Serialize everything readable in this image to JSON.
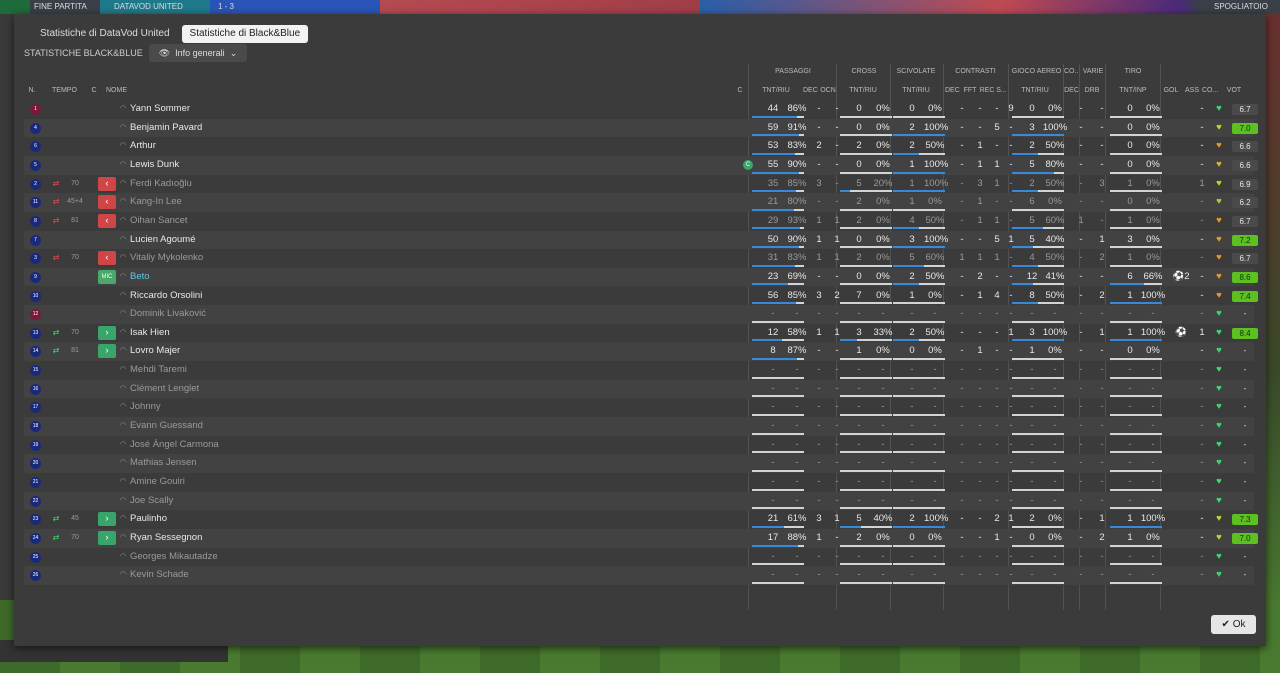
{
  "topbar": {
    "left": "FINE PARTITA",
    "team": "DATAVOD UNITED",
    "score": "1 - 3",
    "right": "SPOGLIATOIO"
  },
  "tabs": [
    {
      "label": "Statistiche di DataVod United",
      "active": false
    },
    {
      "label": "Statistiche di Black&Blue",
      "active": true
    }
  ],
  "subtitle": "STATISTICHE BLACK&BLUE",
  "dropdown": "Info generali",
  "groups": {
    "passaggi": "PASSAGGI",
    "cross": "CROSS",
    "scivolate": "SCIVOLATE",
    "contrasti": "CONTRASTI",
    "gioco_aereo": "GIOCO AEREO",
    "co": "CO...",
    "varie": "VARIE",
    "tiro": "TIRO"
  },
  "headers": {
    "n": "N.",
    "tempo": "TEMPO",
    "c": "C",
    "nome": "NOME",
    "c2": "C",
    "pass": "TNT/RIU",
    "pass_dec": "DEC",
    "pass_ocn": "OCN",
    "cross": "TNT/RIU",
    "sciv": "TNT/RIU",
    "con_dec": "DEC",
    "con_fft": "FFT",
    "con_rec": "REC",
    "con_s": "S...",
    "aereo": "TNT/RIU",
    "co_dec": "DEC",
    "drb": "DRB",
    "tiro": "TNT/INP",
    "gol": "GOL",
    "ass": "ASS",
    "cond": "CO...",
    "vot": "VOT"
  },
  "ok_label": "Ok",
  "players": [
    {
      "n": "1",
      "name": "Yann Sommer",
      "kit": "#7a1a3a",
      "sub": "",
      "tempo": "",
      "role": "",
      "pas": "44",
      "pasp": "86%",
      "pd": "-",
      "po": "-",
      "cr": "0",
      "crp": "0%",
      "sc": "0",
      "scp": "0%",
      "cd": "-",
      "cf": "-",
      "cre": "-",
      "cs": "9",
      "ae": "0",
      "aep": "0%",
      "od": "-",
      "dr": "-",
      "ti": "0",
      "tip": "0%",
      "gol": "",
      "ass": "-",
      "heart": "#39d96a",
      "vot": "6.7",
      "vhi": false,
      "active": true,
      "cap": false
    },
    {
      "n": "4",
      "name": "Benjamin Pavard",
      "kit": "#1a2a7a",
      "sub": "",
      "tempo": "",
      "role": "",
      "pas": "59",
      "pasp": "91%",
      "pd": "-",
      "po": "-",
      "cr": "0",
      "crp": "0%",
      "sc": "2",
      "scp": "100%",
      "cd": "-",
      "cf": "-",
      "cre": "5",
      "cs": "-",
      "ae": "3",
      "aep": "100%",
      "od": "-",
      "dr": "-",
      "ti": "0",
      "tip": "0%",
      "gol": "",
      "ass": "-",
      "heart": "#c8d030",
      "vot": "7.0",
      "vhi": true,
      "active": true,
      "cap": false
    },
    {
      "n": "6",
      "name": "Arthur",
      "kit": "#1a2a7a",
      "sub": "",
      "tempo": "",
      "role": "",
      "pas": "53",
      "pasp": "83%",
      "pd": "2",
      "po": "-",
      "cr": "2",
      "crp": "0%",
      "sc": "2",
      "scp": "50%",
      "cd": "-",
      "cf": "1",
      "cre": "-",
      "cs": "-",
      "ae": "2",
      "aep": "50%",
      "od": "-",
      "dr": "-",
      "ti": "0",
      "tip": "0%",
      "gol": "",
      "ass": "-",
      "heart": "#e09a30",
      "vot": "6.6",
      "vhi": false,
      "active": true,
      "cap": false
    },
    {
      "n": "5",
      "name": "Lewis Dunk",
      "kit": "#1a2a7a",
      "sub": "",
      "tempo": "",
      "role": "",
      "pas": "55",
      "pasp": "90%",
      "pd": "-",
      "po": "-",
      "cr": "0",
      "crp": "0%",
      "sc": "1",
      "scp": "100%",
      "cd": "-",
      "cf": "1",
      "cre": "1",
      "cs": "-",
      "ae": "5",
      "aep": "80%",
      "od": "-",
      "dr": "-",
      "ti": "0",
      "tip": "0%",
      "gol": "",
      "ass": "-",
      "heart": "#e0b030",
      "vot": "6.6",
      "vhi": false,
      "active": true,
      "cap": true
    },
    {
      "n": "2",
      "name": "Ferdi Kadıoğlu",
      "kit": "#1a2a7a",
      "sub": "out",
      "tempo": "70",
      "role": "",
      "pas": "35",
      "pasp": "85%",
      "pd": "3",
      "po": "-",
      "cr": "5",
      "crp": "20%",
      "sc": "1",
      "scp": "100%",
      "cd": "-",
      "cf": "3",
      "cre": "1",
      "cs": "-",
      "ae": "2",
      "aep": "50%",
      "od": "-",
      "dr": "3",
      "ti": "1",
      "tip": "0%",
      "gol": "",
      "ass": "1",
      "heart": "#c8d030",
      "vot": "6.9",
      "vhi": false,
      "active": false,
      "cap": false
    },
    {
      "n": "11",
      "name": "Kang-In Lee",
      "kit": "#1a2a7a",
      "sub": "out",
      "tempo": "45+4",
      "role": "",
      "pas": "21",
      "pasp": "80%",
      "pd": "-",
      "po": "-",
      "cr": "2",
      "crp": "0%",
      "sc": "1",
      "scp": "0%",
      "cd": "-",
      "cf": "1",
      "cre": "-",
      "cs": "-",
      "ae": "6",
      "aep": "0%",
      "od": "-",
      "dr": "-",
      "ti": "0",
      "tip": "0%",
      "gol": "",
      "ass": "-",
      "heart": "#a0d040",
      "vot": "6.2",
      "vhi": false,
      "active": false,
      "cap": false
    },
    {
      "n": "8",
      "name": "Oihan Sancet",
      "kit": "#1a2a7a",
      "sub": "out",
      "tempo": "81",
      "role": "",
      "pas": "29",
      "pasp": "93%",
      "pd": "1",
      "po": "1",
      "cr": "2",
      "crp": "0%",
      "sc": "4",
      "scp": "50%",
      "cd": "-",
      "cf": "1",
      "cre": "1",
      "cs": "-",
      "ae": "5",
      "aep": "60%",
      "od": "1",
      "dr": "-",
      "ti": "1",
      "tip": "0%",
      "gol": "",
      "ass": "-",
      "heart": "#e09a30",
      "vot": "6.7",
      "vhi": false,
      "active": false,
      "cap": false
    },
    {
      "n": "7",
      "name": "Lucien Agoumé",
      "kit": "#1a2a7a",
      "sub": "",
      "tempo": "",
      "role": "",
      "pas": "50",
      "pasp": "90%",
      "pd": "1",
      "po": "1",
      "cr": "0",
      "crp": "0%",
      "sc": "3",
      "scp": "100%",
      "cd": "-",
      "cf": "-",
      "cre": "5",
      "cs": "1",
      "ae": "5",
      "aep": "40%",
      "od": "-",
      "dr": "1",
      "ti": "3",
      "tip": "0%",
      "gol": "",
      "ass": "-",
      "heart": "#e09a30",
      "vot": "7.2",
      "vhi": true,
      "active": true,
      "cap": false
    },
    {
      "n": "3",
      "name": "Vitaliy Mykolenko",
      "kit": "#1a2a7a",
      "sub": "out",
      "tempo": "70",
      "role": "",
      "pas": "31",
      "pasp": "83%",
      "pd": "1",
      "po": "1",
      "cr": "2",
      "crp": "0%",
      "sc": "5",
      "scp": "60%",
      "cd": "1",
      "cf": "1",
      "cre": "1",
      "cs": "-",
      "ae": "4",
      "aep": "50%",
      "od": "-",
      "dr": "2",
      "ti": "1",
      "tip": "0%",
      "gol": "",
      "ass": "-",
      "heart": "#e09a30",
      "vot": "6.7",
      "vhi": false,
      "active": false,
      "cap": false
    },
    {
      "n": "9",
      "name": "Beto",
      "kit": "#1a2a7a",
      "sub": "",
      "tempo": "",
      "role": "MIC",
      "pas": "23",
      "pasp": "69%",
      "pd": "-",
      "po": "-",
      "cr": "0",
      "crp": "0%",
      "sc": "2",
      "scp": "50%",
      "cd": "-",
      "cf": "2",
      "cre": "-",
      "cs": "-",
      "ae": "12",
      "aep": "41%",
      "od": "-",
      "dr": "-",
      "ti": "6",
      "tip": "66%",
      "gol": "⚽2",
      "ass": "-",
      "heart": "#e09a30",
      "vot": "8.6",
      "vhi": true,
      "active": true,
      "cap": false,
      "motm": true
    },
    {
      "n": "10",
      "name": "Riccardo Orsolini",
      "kit": "#1a2a7a",
      "sub": "",
      "tempo": "",
      "role": "",
      "pas": "56",
      "pasp": "85%",
      "pd": "3",
      "po": "2",
      "cr": "7",
      "crp": "0%",
      "sc": "1",
      "scp": "0%",
      "cd": "-",
      "cf": "1",
      "cre": "4",
      "cs": "-",
      "ae": "8",
      "aep": "50%",
      "od": "-",
      "dr": "2",
      "ti": "1",
      "tip": "100%",
      "gol": "",
      "ass": "-",
      "heart": "#e09a30",
      "vot": "7.4",
      "vhi": true,
      "active": true,
      "cap": false
    },
    {
      "n": "12",
      "name": "Dominik Livaković",
      "kit": "#7a1a3a",
      "sub": "",
      "tempo": "",
      "role": "",
      "pas": "-",
      "pasp": "-",
      "pd": "-",
      "po": "-",
      "cr": "-",
      "crp": "-",
      "sc": "-",
      "scp": "-",
      "cd": "-",
      "cf": "-",
      "cre": "-",
      "cs": "-",
      "ae": "-",
      "aep": "-",
      "od": "-",
      "dr": "-",
      "ti": "-",
      "tip": "-",
      "gol": "",
      "ass": "-",
      "heart": "#39d96a",
      "vot": "-",
      "vhi": false,
      "active": false,
      "cap": false
    },
    {
      "n": "13",
      "name": "Isak Hien",
      "kit": "#1a2a7a",
      "sub": "in",
      "tempo": "70",
      "role": "",
      "pas": "12",
      "pasp": "58%",
      "pd": "1",
      "po": "1",
      "cr": "3",
      "crp": "33%",
      "sc": "2",
      "scp": "50%",
      "cd": "-",
      "cf": "-",
      "cre": "-",
      "cs": "1",
      "ae": "3",
      "aep": "100%",
      "od": "-",
      "dr": "1",
      "ti": "1",
      "tip": "100%",
      "gol": "⚽",
      "ass": "1",
      "heart": "#39d96a",
      "vot": "8.4",
      "vhi": true,
      "active": true,
      "cap": false
    },
    {
      "n": "14",
      "name": "Lovro Majer",
      "kit": "#1a2a7a",
      "sub": "in",
      "tempo": "81",
      "role": "",
      "pas": "8",
      "pasp": "87%",
      "pd": "-",
      "po": "-",
      "cr": "1",
      "crp": "0%",
      "sc": "0",
      "scp": "0%",
      "cd": "-",
      "cf": "1",
      "cre": "-",
      "cs": "-",
      "ae": "1",
      "aep": "0%",
      "od": "-",
      "dr": "-",
      "ti": "0",
      "tip": "0%",
      "gol": "",
      "ass": "-",
      "heart": "#39d96a",
      "vot": "-",
      "vhi": false,
      "active": true,
      "cap": false
    },
    {
      "n": "15",
      "name": "Mehdi Taremi",
      "kit": "#1a2a7a",
      "sub": "",
      "tempo": "",
      "role": "",
      "pas": "-",
      "pasp": "-",
      "pd": "-",
      "po": "-",
      "cr": "-",
      "crp": "-",
      "sc": "-",
      "scp": "-",
      "cd": "-",
      "cf": "-",
      "cre": "-",
      "cs": "-",
      "ae": "-",
      "aep": "-",
      "od": "-",
      "dr": "-",
      "ti": "-",
      "tip": "-",
      "gol": "",
      "ass": "-",
      "heart": "#39d96a",
      "vot": "-",
      "vhi": false,
      "active": false,
      "cap": false
    },
    {
      "n": "16",
      "name": "Clément Lenglet",
      "kit": "#1a2a7a",
      "sub": "",
      "tempo": "",
      "role": "",
      "pas": "-",
      "pasp": "-",
      "pd": "-",
      "po": "-",
      "cr": "-",
      "crp": "-",
      "sc": "-",
      "scp": "-",
      "cd": "-",
      "cf": "-",
      "cre": "-",
      "cs": "-",
      "ae": "-",
      "aep": "-",
      "od": "-",
      "dr": "-",
      "ti": "-",
      "tip": "-",
      "gol": "",
      "ass": "-",
      "heart": "#39d96a",
      "vot": "-",
      "vhi": false,
      "active": false,
      "cap": false
    },
    {
      "n": "17",
      "name": "Johnny",
      "kit": "#1a2a7a",
      "sub": "",
      "tempo": "",
      "role": "",
      "pas": "-",
      "pasp": "-",
      "pd": "-",
      "po": "-",
      "cr": "-",
      "crp": "-",
      "sc": "-",
      "scp": "-",
      "cd": "-",
      "cf": "-",
      "cre": "-",
      "cs": "-",
      "ae": "-",
      "aep": "-",
      "od": "-",
      "dr": "-",
      "ti": "-",
      "tip": "-",
      "gol": "",
      "ass": "-",
      "heart": "#39d96a",
      "vot": "-",
      "vhi": false,
      "active": false,
      "cap": false
    },
    {
      "n": "18",
      "name": "Evann Guessand",
      "kit": "#1a2a7a",
      "sub": "",
      "tempo": "",
      "role": "",
      "pas": "-",
      "pasp": "-",
      "pd": "-",
      "po": "-",
      "cr": "-",
      "crp": "-",
      "sc": "-",
      "scp": "-",
      "cd": "-",
      "cf": "-",
      "cre": "-",
      "cs": "-",
      "ae": "-",
      "aep": "-",
      "od": "-",
      "dr": "-",
      "ti": "-",
      "tip": "-",
      "gol": "",
      "ass": "-",
      "heart": "#39d96a",
      "vot": "-",
      "vhi": false,
      "active": false,
      "cap": false
    },
    {
      "n": "19",
      "name": "José Ángel Carmona",
      "kit": "#1a2a7a",
      "sub": "",
      "tempo": "",
      "role": "",
      "pas": "-",
      "pasp": "-",
      "pd": "-",
      "po": "-",
      "cr": "-",
      "crp": "-",
      "sc": "-",
      "scp": "-",
      "cd": "-",
      "cf": "-",
      "cre": "-",
      "cs": "-",
      "ae": "-",
      "aep": "-",
      "od": "-",
      "dr": "-",
      "ti": "-",
      "tip": "-",
      "gol": "",
      "ass": "-",
      "heart": "#39d96a",
      "vot": "-",
      "vhi": false,
      "active": false,
      "cap": false
    },
    {
      "n": "20",
      "name": "Mathias Jensen",
      "kit": "#1a2a7a",
      "sub": "",
      "tempo": "",
      "role": "",
      "pas": "-",
      "pasp": "-",
      "pd": "-",
      "po": "-",
      "cr": "-",
      "crp": "-",
      "sc": "-",
      "scp": "-",
      "cd": "-",
      "cf": "-",
      "cre": "-",
      "cs": "-",
      "ae": "-",
      "aep": "-",
      "od": "-",
      "dr": "-",
      "ti": "-",
      "tip": "-",
      "gol": "",
      "ass": "-",
      "heart": "#39d96a",
      "vot": "-",
      "vhi": false,
      "active": false,
      "cap": false
    },
    {
      "n": "21",
      "name": "Amine Gouiri",
      "kit": "#1a2a7a",
      "sub": "",
      "tempo": "",
      "role": "",
      "pas": "-",
      "pasp": "-",
      "pd": "-",
      "po": "-",
      "cr": "-",
      "crp": "-",
      "sc": "-",
      "scp": "-",
      "cd": "-",
      "cf": "-",
      "cre": "-",
      "cs": "-",
      "ae": "-",
      "aep": "-",
      "od": "-",
      "dr": "-",
      "ti": "-",
      "tip": "-",
      "gol": "",
      "ass": "-",
      "heart": "#39d96a",
      "vot": "-",
      "vhi": false,
      "active": false,
      "cap": false
    },
    {
      "n": "22",
      "name": "Joe Scally",
      "kit": "#1a2a7a",
      "sub": "",
      "tempo": "",
      "role": "",
      "pas": "-",
      "pasp": "-",
      "pd": "-",
      "po": "-",
      "cr": "-",
      "crp": "-",
      "sc": "-",
      "scp": "-",
      "cd": "-",
      "cf": "-",
      "cre": "-",
      "cs": "-",
      "ae": "-",
      "aep": "-",
      "od": "-",
      "dr": "-",
      "ti": "-",
      "tip": "-",
      "gol": "",
      "ass": "-",
      "heart": "#39d96a",
      "vot": "-",
      "vhi": false,
      "active": false,
      "cap": false
    },
    {
      "n": "23",
      "name": "Paulinho",
      "kit": "#1a2a7a",
      "sub": "in",
      "tempo": "45",
      "role": "",
      "pas": "21",
      "pasp": "61%",
      "pd": "3",
      "po": "1",
      "cr": "5",
      "crp": "40%",
      "sc": "2",
      "scp": "100%",
      "cd": "-",
      "cf": "-",
      "cre": "2",
      "cs": "1",
      "ae": "2",
      "aep": "0%",
      "od": "-",
      "dr": "1",
      "ti": "1",
      "tip": "100%",
      "gol": "",
      "ass": "-",
      "heart": "#c8d030",
      "vot": "7.3",
      "vhi": true,
      "active": true,
      "cap": false
    },
    {
      "n": "24",
      "name": "Ryan Sessegnon",
      "kit": "#1a2a7a",
      "sub": "in",
      "tempo": "70",
      "role": "",
      "pas": "17",
      "pasp": "88%",
      "pd": "1",
      "po": "-",
      "cr": "2",
      "crp": "0%",
      "sc": "0",
      "scp": "0%",
      "cd": "-",
      "cf": "-",
      "cre": "1",
      "cs": "-",
      "ae": "0",
      "aep": "0%",
      "od": "-",
      "dr": "2",
      "ti": "1",
      "tip": "0%",
      "gol": "",
      "ass": "-",
      "heart": "#c8d030",
      "vot": "7.0",
      "vhi": true,
      "active": true,
      "cap": false
    },
    {
      "n": "25",
      "name": "Georges Mikautadze",
      "kit": "#1a2a7a",
      "sub": "",
      "tempo": "",
      "role": "",
      "pas": "-",
      "pasp": "-",
      "pd": "-",
      "po": "-",
      "cr": "-",
      "crp": "-",
      "sc": "-",
      "scp": "-",
      "cd": "-",
      "cf": "-",
      "cre": "-",
      "cs": "-",
      "ae": "-",
      "aep": "-",
      "od": "-",
      "dr": "-",
      "ti": "-",
      "tip": "-",
      "gol": "",
      "ass": "-",
      "heart": "#39d96a",
      "vot": "-",
      "vhi": false,
      "active": false,
      "cap": false
    },
    {
      "n": "26",
      "name": "Kevin Schade",
      "kit": "#1a2a7a",
      "sub": "",
      "tempo": "",
      "role": "",
      "pas": "-",
      "pasp": "-",
      "pd": "-",
      "po": "-",
      "cr": "-",
      "crp": "-",
      "sc": "-",
      "scp": "-",
      "cd": "-",
      "cf": "-",
      "cre": "-",
      "cs": "-",
      "ae": "-",
      "aep": "-",
      "od": "-",
      "dr": "-",
      "ti": "-",
      "tip": "-",
      "gol": "",
      "ass": "-",
      "heart": "#39d96a",
      "vot": "-",
      "vhi": false,
      "active": false,
      "cap": false
    }
  ]
}
